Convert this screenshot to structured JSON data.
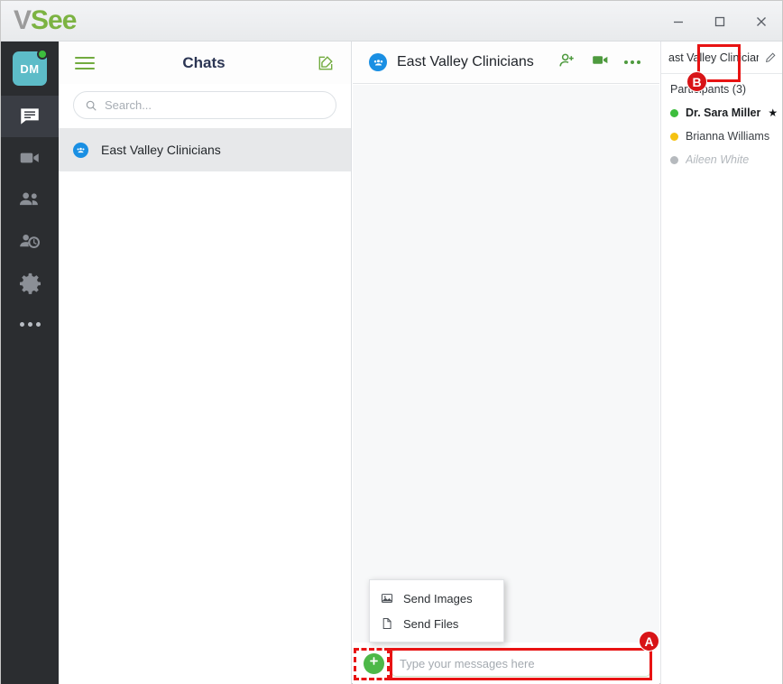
{
  "window": {
    "brand_v": "V",
    "brand_see": "See",
    "minimize_label": "Minimize",
    "maximize_label": "Maximize",
    "close_label": "Close"
  },
  "colors": {
    "brand_green": "#7cb342",
    "accent_green": "#4db848",
    "group_blue": "#1a8fe3",
    "rail_dark": "#2b2d30",
    "annotation_red": "#e81313",
    "status_online": "#3dbd3d",
    "status_away": "#f5c211",
    "status_offline": "#b6babe"
  },
  "rail": {
    "avatar_initials": "DM",
    "presence": "online",
    "items": [
      {
        "name": "chats",
        "icon": "chat-bubble-icon",
        "active": true
      },
      {
        "name": "calls",
        "icon": "video-camera-icon",
        "active": false
      },
      {
        "name": "contacts",
        "icon": "people-icon",
        "active": false
      },
      {
        "name": "history",
        "icon": "recent-history-icon",
        "active": false
      },
      {
        "name": "settings",
        "icon": "gear-icon",
        "active": false
      },
      {
        "name": "more",
        "icon": "more-dots-icon",
        "active": false
      }
    ]
  },
  "chatlist": {
    "menu_icon": "hamburger-icon",
    "title": "Chats",
    "compose_icon": "compose-icon",
    "search": {
      "icon": "search-icon",
      "value": "",
      "placeholder": "Search..."
    },
    "conversations": [
      {
        "name": "East Valley Clinicians",
        "icon": "group-icon",
        "selected": true
      }
    ]
  },
  "main": {
    "icon": "group-icon",
    "title": "East Valley Clinicians",
    "actions": [
      {
        "name": "add-participant",
        "icon": "add-person-icon"
      },
      {
        "name": "start-video-call",
        "icon": "video-camera-icon"
      },
      {
        "name": "more-options",
        "icon": "more-dots-icon"
      }
    ],
    "composer": {
      "attach_icon": "plus-icon",
      "input_value": "",
      "input_placeholder": "Type your messages here"
    },
    "attach_menu": {
      "items": [
        {
          "label": "Send Images",
          "icon": "image-icon"
        },
        {
          "label": "Send Files",
          "icon": "file-icon"
        }
      ]
    }
  },
  "participants": {
    "header_title": "ast Valley Clinicians",
    "edit_icon": "pencil-icon",
    "count_label": "Participants",
    "count_value": "(3)",
    "people": [
      {
        "name": "Dr. Sara Miller",
        "status": "online",
        "host": true,
        "star": "★"
      },
      {
        "name": "Brianna Williams",
        "status": "away",
        "host": false,
        "star": ""
      },
      {
        "name": "Aileen White",
        "status": "offline",
        "host": false,
        "star": ""
      }
    ]
  },
  "annotations": [
    {
      "label": "A",
      "target": "message-input-highlight"
    },
    {
      "label": "B",
      "target": "video-call-button-highlight"
    }
  ]
}
